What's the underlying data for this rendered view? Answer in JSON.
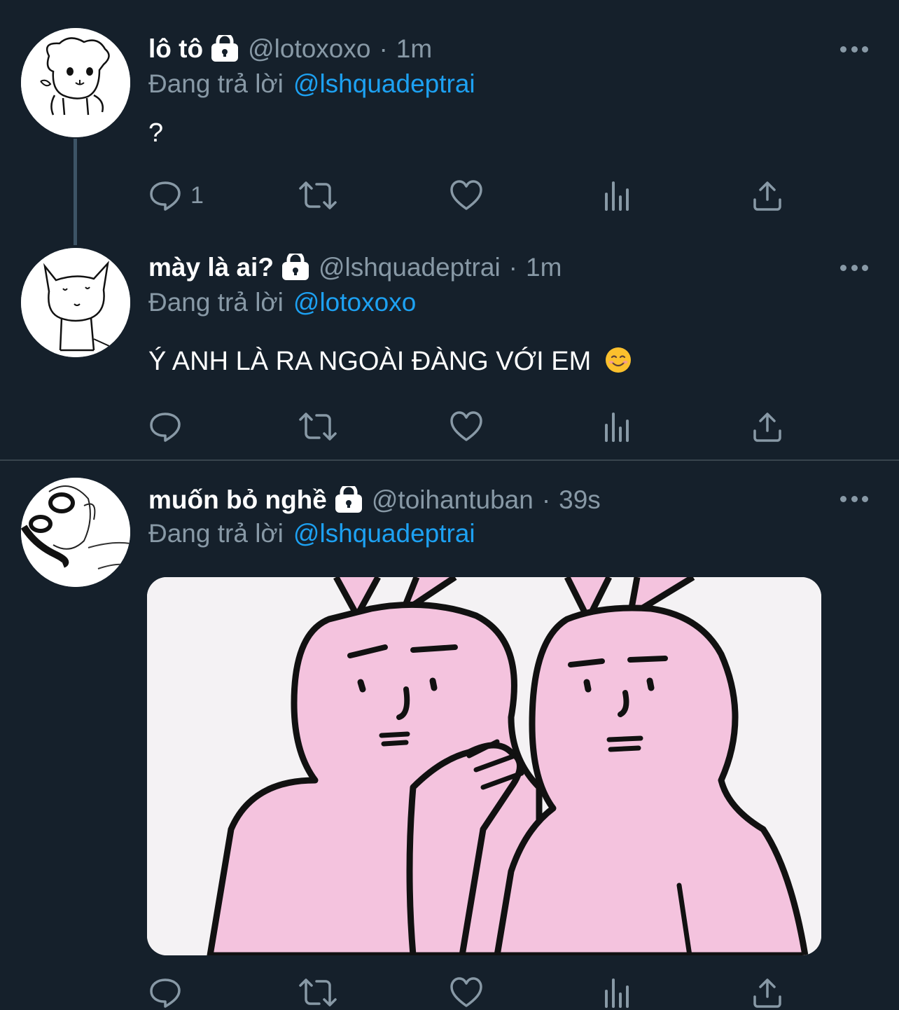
{
  "tweets": [
    {
      "name": "lô tô",
      "handle": "@lotoxoxo",
      "time": "1m",
      "replying_label": "Đang trả lời",
      "replying_to": "@lshquadeptrai",
      "text": "?",
      "reply_count": "1",
      "avatar_icon": "dog-drawing-avatar"
    },
    {
      "name": "mày là ai?",
      "handle": "@lshquadeptrai",
      "time": "1m",
      "replying_label": "Đang trả lời",
      "replying_to": "@lotoxoxo",
      "text": "Ý ANH LÀ RA NGOÀI ĐÀNG VỚI EM",
      "emoji": "smiling-face-emoji",
      "reply_count": "",
      "avatar_icon": "cat-drawing-avatar"
    },
    {
      "name": "muốn bỏ nghề",
      "handle": "@toihantuban",
      "time": "39s",
      "replying_label": "Đang trả lời",
      "replying_to": "@lshquadeptrai",
      "reply_count": "",
      "avatar_icon": "sketch-face-avatar",
      "media": "pink-bunnies-whisper-image"
    }
  ],
  "separator_dot": "·",
  "icons": {
    "lock": "lock-icon",
    "more": "more-icon",
    "reply": "reply-icon",
    "retweet": "retweet-icon",
    "like": "like-icon",
    "analytics": "analytics-icon",
    "share": "share-icon"
  },
  "colors": {
    "background": "#15202b",
    "primary_text": "#ffffff",
    "secondary_text": "#8899a6",
    "accent": "#1da1f2",
    "divider": "#38444d",
    "thread_line": "#3d5466"
  }
}
